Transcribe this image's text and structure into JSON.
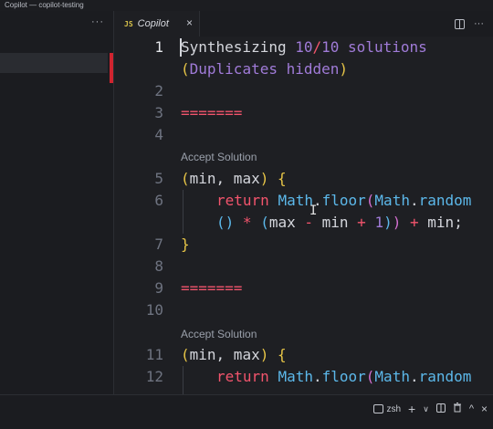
{
  "window": {
    "title": "Copilot — copilot-testing"
  },
  "sidebar": {
    "more_label": "···"
  },
  "tab": {
    "lang_badge": "JS",
    "title": "Copilot",
    "close_label": "×"
  },
  "tab_actions": {
    "split_icon": "split-editor-icon",
    "more_label": "···"
  },
  "editor": {
    "header_line1": "Synthesizing 10/10 solutions",
    "header_line2": "(Duplicates hidden)",
    "separator": "=======",
    "codelens": "Accept Solution",
    "line_numbers": [
      "1",
      "2",
      "3",
      "4",
      "5",
      "6",
      "7",
      "8",
      "9",
      "10",
      "11",
      "12"
    ],
    "solution_signature": "(min, max) {",
    "solution_return": "return Math.floor(Math.random",
    "solution_return_cont": "() * (max - min + 1)) + min;",
    "solution_close": "}"
  },
  "panel": {
    "terminal_label": "zsh",
    "add_label": "+",
    "chevron": "∨",
    "split_icon": "split-terminal-icon",
    "trash_icon": "trash-icon",
    "collapse_label": "^",
    "close_label": "×"
  },
  "colors": {
    "background": "#1e1f23",
    "keyword": "#f2546c",
    "number": "#a07bd8",
    "class": "#5cb8ea",
    "bracket": "#e7c547",
    "line_number": "#6e7380"
  }
}
